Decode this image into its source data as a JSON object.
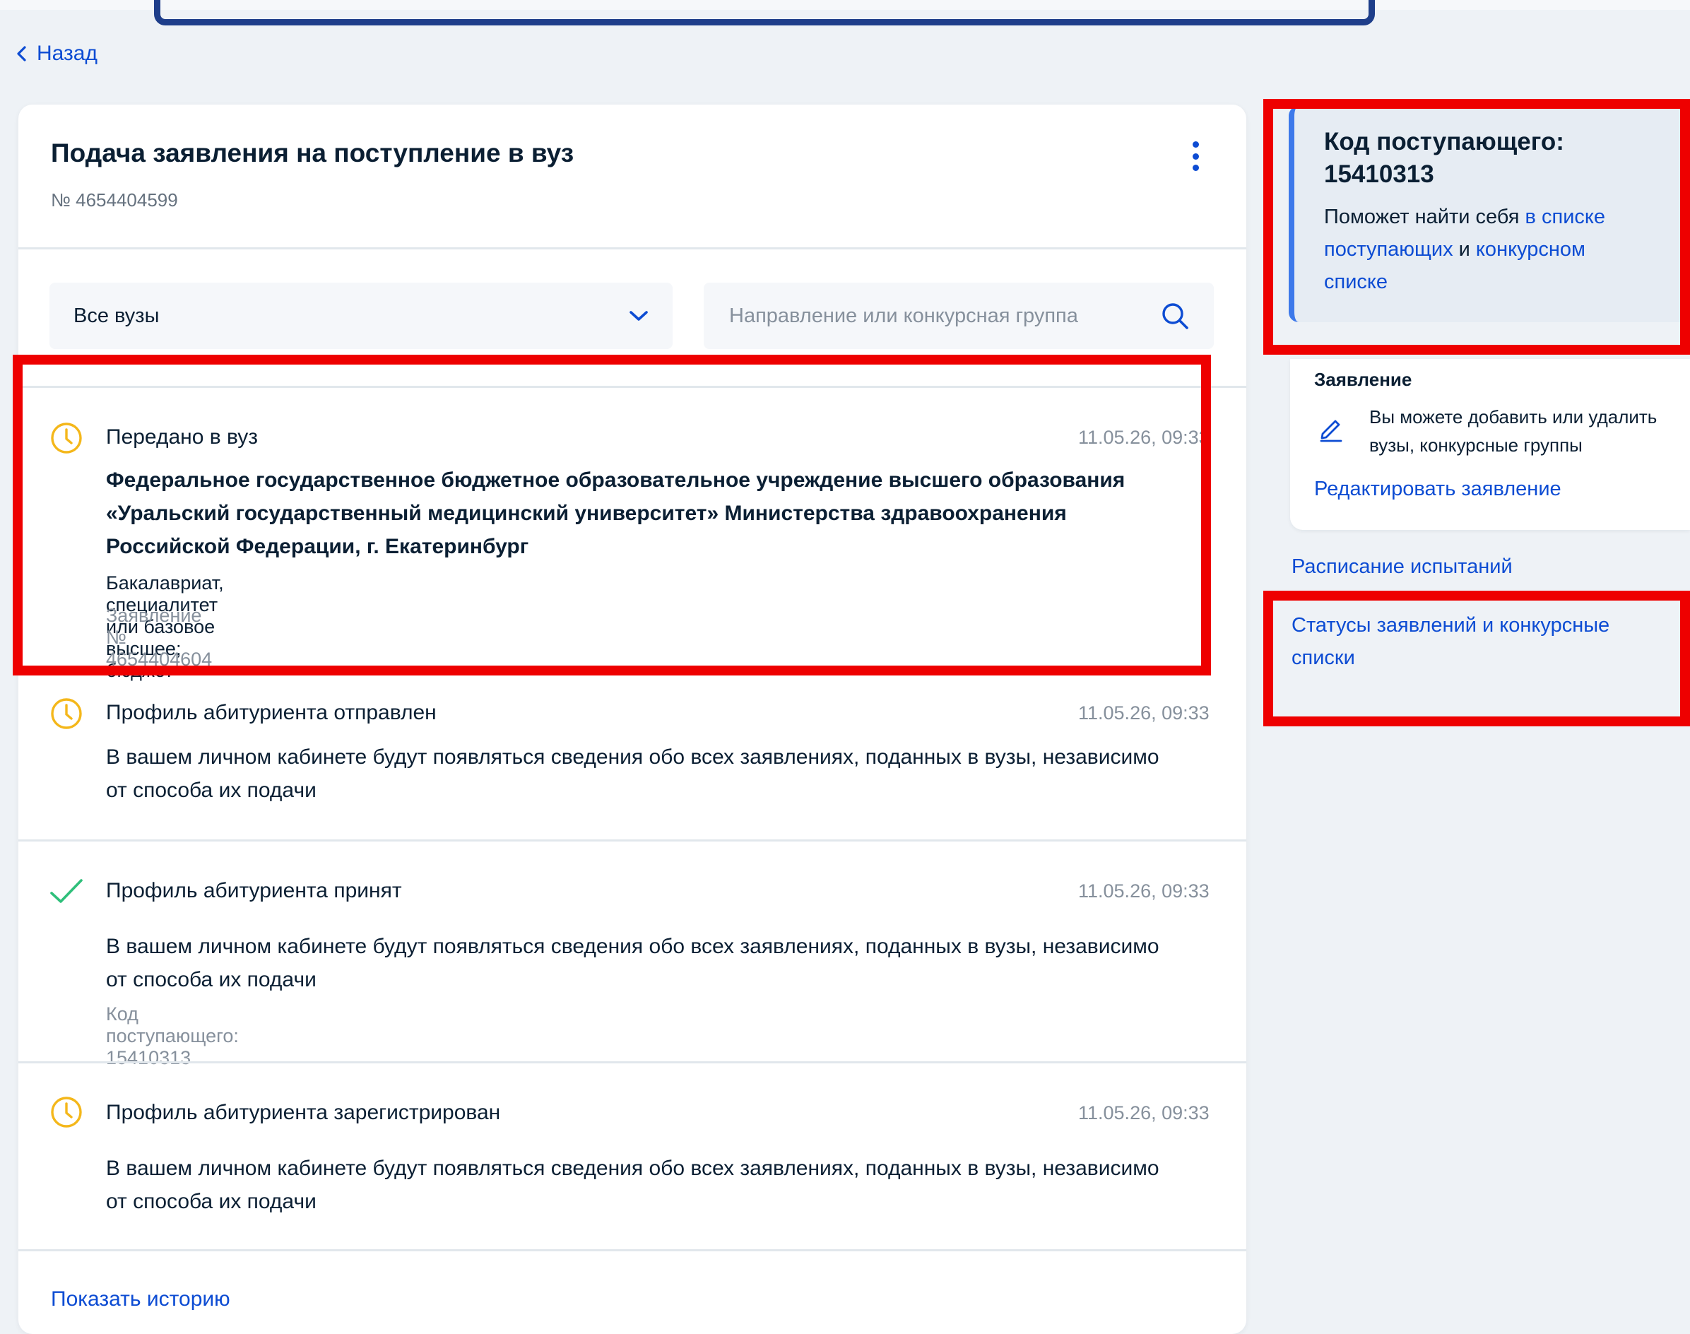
{
  "nav": {
    "back_label": "Назад"
  },
  "application": {
    "title": "Подача заявления на поступление в вуз",
    "number": "№ 4654404599"
  },
  "filters": {
    "university_select_value": "Все вузы",
    "search_placeholder": "Направление или конкурсная группа"
  },
  "timeline": [
    {
      "status": "pending",
      "icon": "clock-icon",
      "title": "Передано в вуз",
      "time": "11.05.26, 09:33",
      "organization": [
        "Федеральное государственное бюджетное образовательное учреждение высшего образования",
        "«Уральский государственный медицинский университет» Министерства здравоохранения",
        "Российской Федерации, г. Екатеринбург"
      ],
      "program": "Бакалавриат, специалитет или базовое высшее; бюджет",
      "application_ref": "Заявление № 4654404604"
    },
    {
      "status": "pending",
      "icon": "clock-icon",
      "title": "Профиль абитуриента отправлен",
      "time": "11.05.26, 09:33",
      "body": [
        "В вашем личном кабинете будут появляться сведения обо всех заявлениях, поданных в вузы, независимо",
        "от способа их подачи"
      ]
    },
    {
      "status": "done",
      "icon": "checkmark-icon",
      "title": "Профиль абитуриента принят",
      "time": "11.05.26, 09:33",
      "body": [
        "В вашем личном кабинете будут появляться сведения обо всех заявлениях, поданных в вузы, независимо",
        "от способа их подачи"
      ],
      "extra": "Код поступающего: 15410313"
    },
    {
      "status": "pending",
      "icon": "clock-icon",
      "title": "Профиль абитуриента зарегистрирован",
      "time": "11.05.26, 09:33",
      "body": [
        "В вашем личном кабинете будут появляться сведения обо всех заявлениях, поданных в вузы, независимо",
        "от способа их подачи"
      ]
    }
  ],
  "show_history_label": "Показать историю",
  "sidebar": {
    "code_card": {
      "title_line1": "Код поступающего:",
      "title_line2": "15410313",
      "desc_text1": "Поможет найти себя ",
      "desc_link1_a": "в списке",
      "desc_link1_b": "поступающих",
      "desc_text2": " и ",
      "desc_link2_a": "конкурсном",
      "desc_link2_b": "списке"
    },
    "application_card": {
      "heading": "Заявление",
      "text_line1": "Вы можете добавить или удалить",
      "text_line2": "вузы, конкурсные группы",
      "edit_link": "Редактировать заявление"
    },
    "schedule_link": "Расписание испытаний",
    "statuses_link_line1": "Статусы заявлений и конкурсные",
    "statuses_link_line2": "списки"
  },
  "colors": {
    "link": "#0d4cd3",
    "pending_icon": "#f4b71a",
    "done_icon": "#2ebf7a",
    "annotation_red": "#ee0000",
    "annotation_blue": "#1e3e8a"
  }
}
